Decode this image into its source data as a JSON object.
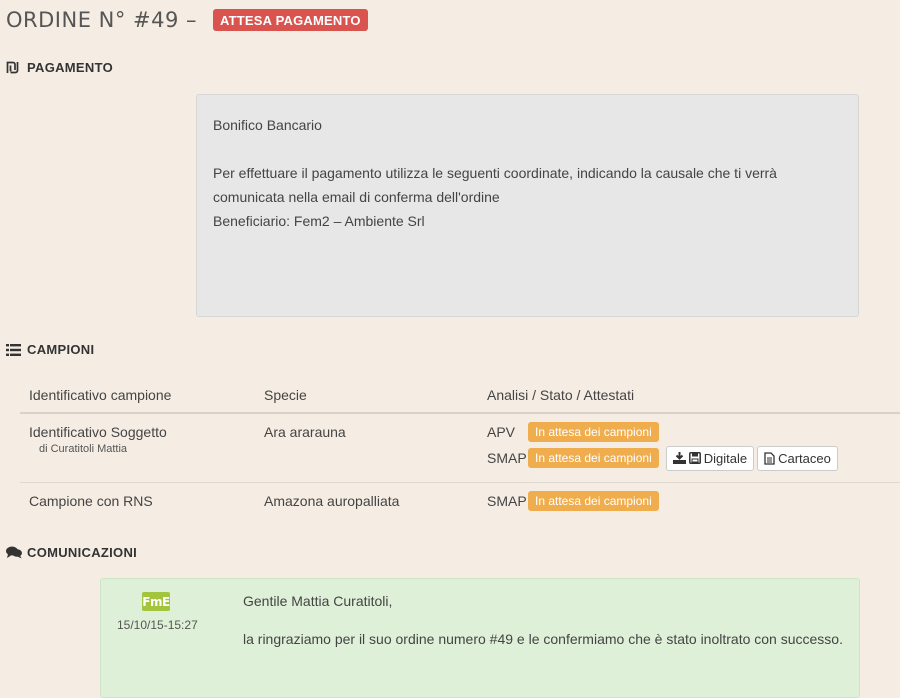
{
  "header": {
    "title": "ORDINE N° #49 –",
    "status": "ATTESA PAGAMENTO",
    "status_color": "#d9534f"
  },
  "payment": {
    "section_title": "PAGAMENTO",
    "icon": "shekel-icon",
    "method": "Bonifico Bancario",
    "instructions": "Per effettuare il pagamento utilizza le seguenti coordinate, indicando la causale che ti verrà comunicata nella email di conferma dell'ordine",
    "beneficiary": "Beneficiario: Fem2 – Ambiente Srl"
  },
  "samples": {
    "section_title": "CAMPIONI",
    "icon": "list-icon",
    "columns": [
      "Identificativo campione",
      "Specie",
      "Analisi / Stato / Attestati"
    ],
    "rows": [
      {
        "id": "Identificativo Soggetto",
        "owner": "di Curatitoli Mattia",
        "species": "Ara ararauna",
        "analyses": [
          {
            "name": "APV",
            "status": "In attesa dei campioni"
          },
          {
            "name": "SMAP",
            "status": "In attesa dei campioni",
            "digital_label": "Digitale",
            "paper_label": "Cartaceo"
          }
        ]
      },
      {
        "id": "Campione con RNS",
        "species": "Amazona auropalliata",
        "analyses": [
          {
            "name": "SMAP",
            "status": "In attesa dei campioni"
          }
        ]
      }
    ],
    "status_color": "#f0ad4e"
  },
  "communications": {
    "section_title": "COMUNICAZIONI",
    "icon": "comments-icon",
    "messages": [
      {
        "logo_text": "FmE",
        "date": "15/10/15-15:27",
        "greeting": "Gentile Mattia Curatitoli,",
        "text": "la ringraziamo per il suo ordine numero #49 e le confermiamo che è stato inoltrato con successo."
      }
    ]
  }
}
